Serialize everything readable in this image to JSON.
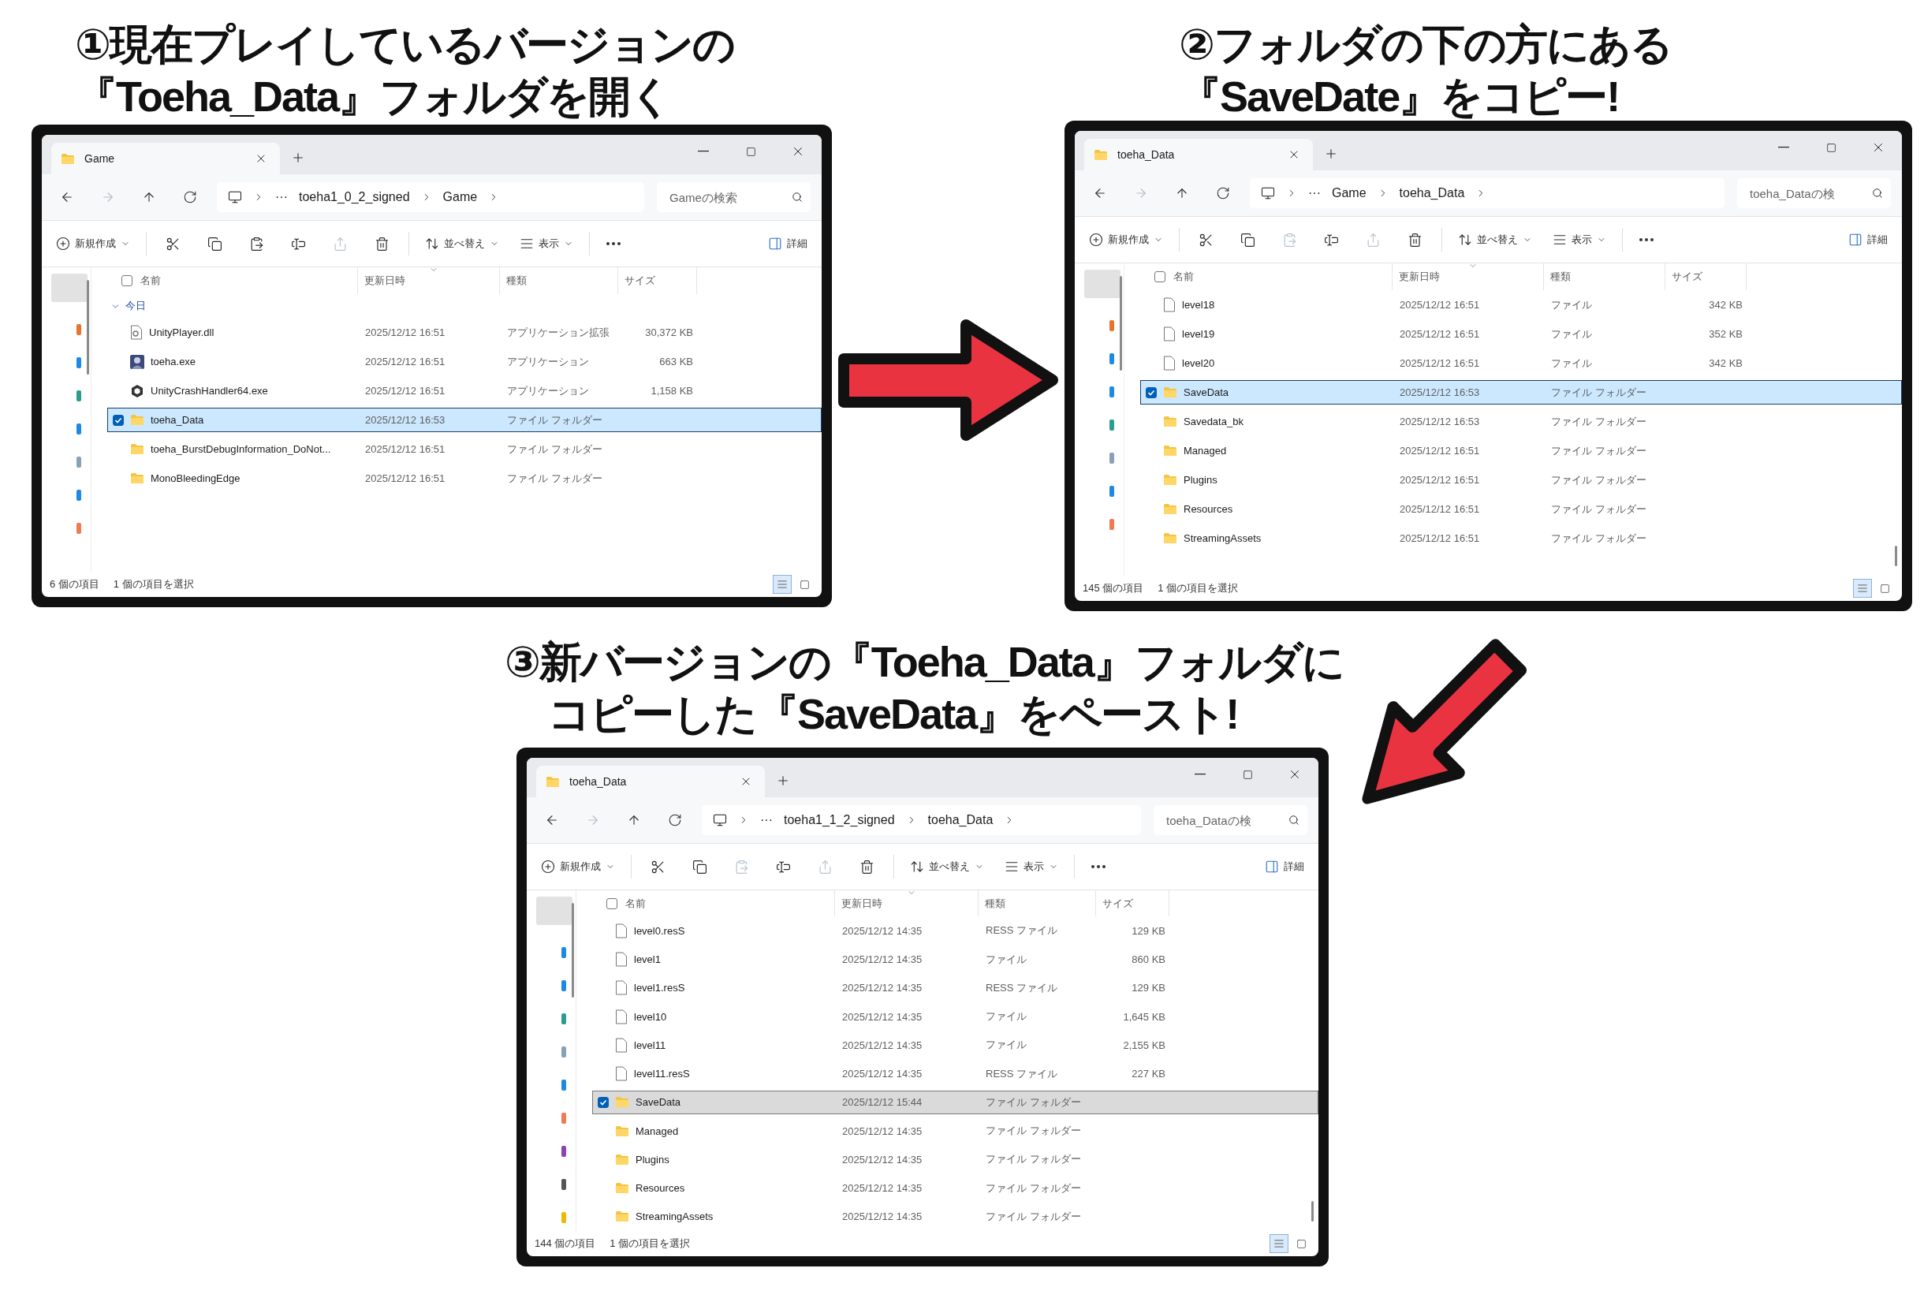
{
  "captions": [
    {
      "lines": [
        "①現在プレイしているバージョンの",
        "『Toeha_Data』フォルダを開く"
      ]
    },
    {
      "lines": [
        "②フォルダの下の方にある",
        "『SaveDate』をコピー!"
      ]
    },
    {
      "lines": [
        "③新バージョンの『Toeha_Data』フォルダに",
        "コピーした『SaveData』をペースト!"
      ]
    }
  ],
  "windows": [
    {
      "tab_title": "Game",
      "focused": true,
      "nav": [
        {
          "kind": "back",
          "disabled": false
        },
        {
          "kind": "forward",
          "disabled": true
        },
        {
          "kind": "up",
          "disabled": false
        },
        {
          "kind": "refresh",
          "disabled": false
        }
      ],
      "address": {
        "ellipsis": "···",
        "crumbs": [
          "toeha1_0_2_signed",
          "Game"
        ]
      },
      "search": {
        "placeholder": "Gameの検索"
      },
      "toolbar": [
        {
          "kind": "new",
          "label": "新規作成"
        },
        {
          "kind": "cut",
          "disabled": false
        },
        {
          "kind": "copy",
          "disabled": false
        },
        {
          "kind": "paste",
          "disabled": false
        },
        {
          "kind": "rename",
          "disabled": false
        },
        {
          "kind": "share",
          "disabled": true
        },
        {
          "kind": "delete",
          "disabled": false
        },
        {
          "kind": "sort",
          "label": "並べ替え"
        },
        {
          "kind": "view",
          "label": "表示"
        },
        {
          "kind": "more"
        },
        {
          "kind": "details",
          "label": "詳細"
        }
      ],
      "select_all": {
        "checked": false
      },
      "columns": [
        {
          "label": "名前",
          "sorted": false
        },
        {
          "label": "更新日時",
          "sorted": true
        },
        {
          "label": "種類",
          "sorted": false
        },
        {
          "label": "サイズ",
          "sorted": false
        }
      ],
      "group": {
        "label": "今日",
        "expanded": true
      },
      "rows": [
        {
          "kind": "dll",
          "name": "UnityPlayer.dll",
          "date": "2025/12/12 16:51",
          "type": "アプリケーション拡張",
          "size": "30,372 KB",
          "selected": false
        },
        {
          "kind": "app",
          "name": "toeha.exe",
          "date": "2025/12/12 16:51",
          "type": "アプリケーション",
          "size": "663 KB",
          "selected": false
        },
        {
          "kind": "unity",
          "name": "UnityCrashHandler64.exe",
          "date": "2025/12/12 16:51",
          "type": "アプリケーション",
          "size": "1,158 KB",
          "selected": false
        },
        {
          "kind": "folder",
          "name": "toeha_Data",
          "date": "2025/12/12 16:53",
          "type": "ファイル フォルダー",
          "selected": true
        },
        {
          "kind": "folder",
          "name": "toeha_BurstDebugInformation_DoNot...",
          "date": "2025/12/12 16:51",
          "type": "ファイル フォルダー",
          "selected": false
        },
        {
          "kind": "folder",
          "name": "MonoBleedingEdge",
          "date": "2025/12/12 16:51",
          "type": "ファイル フォルダー",
          "selected": false
        }
      ],
      "status": {
        "count": "6 個の項目",
        "selection": "1 個の項目を選択"
      },
      "views": [
        {
          "kind": "details",
          "selected": true
        },
        {
          "kind": "tiles",
          "selected": false
        }
      ]
    },
    {
      "tab_title": "toeha_Data",
      "focused": true,
      "nav": [
        {
          "kind": "back",
          "disabled": false
        },
        {
          "kind": "forward",
          "disabled": true
        },
        {
          "kind": "up",
          "disabled": false
        },
        {
          "kind": "refresh",
          "disabled": false
        }
      ],
      "address": {
        "ellipsis": "···",
        "crumbs": [
          "Game",
          "toeha_Data"
        ]
      },
      "search": {
        "placeholder": "toeha_Dataの検"
      },
      "toolbar": [
        {
          "kind": "new",
          "label": "新規作成"
        },
        {
          "kind": "cut",
          "disabled": false
        },
        {
          "kind": "copy",
          "disabled": false
        },
        {
          "kind": "paste",
          "disabled": true
        },
        {
          "kind": "rename",
          "disabled": false
        },
        {
          "kind": "share",
          "disabled": true
        },
        {
          "kind": "delete",
          "disabled": false
        },
        {
          "kind": "sort",
          "label": "並べ替え"
        },
        {
          "kind": "view",
          "label": "表示"
        },
        {
          "kind": "more"
        },
        {
          "kind": "details",
          "label": "詳細"
        }
      ],
      "select_all": {
        "checked": false
      },
      "columns": [
        {
          "label": "名前",
          "sorted": false
        },
        {
          "label": "更新日時",
          "sorted": true
        },
        {
          "label": "種類",
          "sorted": false
        },
        {
          "label": "サイズ",
          "sorted": false
        }
      ],
      "rows": [
        {
          "kind": "file",
          "name": "level18",
          "date": "2025/12/12 16:51",
          "type": "ファイル",
          "size": "342 KB",
          "selected": false
        },
        {
          "kind": "file",
          "name": "level19",
          "date": "2025/12/12 16:51",
          "type": "ファイル",
          "size": "352 KB",
          "selected": false
        },
        {
          "kind": "file",
          "name": "level20",
          "date": "2025/12/12 16:51",
          "type": "ファイル",
          "size": "342 KB",
          "selected": false
        },
        {
          "kind": "folder",
          "name": "SaveData",
          "date": "2025/12/12 16:53",
          "type": "ファイル フォルダー",
          "selected": true
        },
        {
          "kind": "folder",
          "name": "Savedata_bk",
          "date": "2025/12/12 16:53",
          "type": "ファイル フォルダー",
          "selected": false
        },
        {
          "kind": "folder",
          "name": "Managed",
          "date": "2025/12/12 16:51",
          "type": "ファイル フォルダー",
          "selected": false
        },
        {
          "kind": "folder",
          "name": "Plugins",
          "date": "2025/12/12 16:51",
          "type": "ファイル フォルダー",
          "selected": false
        },
        {
          "kind": "folder",
          "name": "Resources",
          "date": "2025/12/12 16:51",
          "type": "ファイル フォルダー",
          "selected": false
        },
        {
          "kind": "folder",
          "name": "StreamingAssets",
          "date": "2025/12/12 16:51",
          "type": "ファイル フォルダー",
          "selected": false
        }
      ],
      "status": {
        "count": "145 個の項目",
        "selection": "1 個の項目を選択"
      },
      "views": [
        {
          "kind": "details",
          "selected": true
        },
        {
          "kind": "tiles",
          "selected": false
        }
      ]
    },
    {
      "tab_title": "toeha_Data",
      "focused": false,
      "nav": [
        {
          "kind": "back",
          "disabled": false
        },
        {
          "kind": "forward",
          "disabled": true
        },
        {
          "kind": "up",
          "disabled": false
        },
        {
          "kind": "refresh",
          "disabled": false
        }
      ],
      "address": {
        "ellipsis": "···",
        "crumbs": [
          "toeha1_1_2_signed",
          "toeha_Data"
        ]
      },
      "search": {
        "placeholder": "toeha_Dataの検"
      },
      "toolbar": [
        {
          "kind": "new",
          "label": "新規作成"
        },
        {
          "kind": "cut",
          "disabled": false
        },
        {
          "kind": "copy",
          "disabled": false
        },
        {
          "kind": "paste",
          "disabled": true
        },
        {
          "kind": "rename",
          "disabled": false
        },
        {
          "kind": "share",
          "disabled": true
        },
        {
          "kind": "delete",
          "disabled": false
        },
        {
          "kind": "sort",
          "label": "並べ替え"
        },
        {
          "kind": "view",
          "label": "表示"
        },
        {
          "kind": "more"
        },
        {
          "kind": "details",
          "label": "詳細"
        }
      ],
      "select_all": {
        "checked": false
      },
      "columns": [
        {
          "label": "名前",
          "sorted": false
        },
        {
          "label": "更新日時",
          "sorted": true
        },
        {
          "label": "種類",
          "sorted": false
        },
        {
          "label": "サイズ",
          "sorted": false
        }
      ],
      "rows": [
        {
          "kind": "file",
          "name": "level0.resS",
          "date": "2025/12/12 14:35",
          "type": "RESS ファイル",
          "size": "129 KB",
          "selected": false
        },
        {
          "kind": "file",
          "name": "level1",
          "date": "2025/12/12 14:35",
          "type": "ファイル",
          "size": "860 KB",
          "selected": false
        },
        {
          "kind": "file",
          "name": "level1.resS",
          "date": "2025/12/12 14:35",
          "type": "RESS ファイル",
          "size": "129 KB",
          "selected": false
        },
        {
          "kind": "file",
          "name": "level10",
          "date": "2025/12/12 14:35",
          "type": "ファイル",
          "size": "1,645 KB",
          "selected": false
        },
        {
          "kind": "file",
          "name": "level11",
          "date": "2025/12/12 14:35",
          "type": "ファイル",
          "size": "2,155 KB",
          "selected": false
        },
        {
          "kind": "file",
          "name": "level11.resS",
          "date": "2025/12/12 14:35",
          "type": "RESS ファイル",
          "size": "227 KB",
          "selected": false
        },
        {
          "kind": "folder",
          "name": "SaveData",
          "date": "2025/12/12 15:44",
          "type": "ファイル フォルダー",
          "selected": true
        },
        {
          "kind": "folder",
          "name": "Managed",
          "date": "2025/12/12 14:35",
          "type": "ファイル フォルダー",
          "selected": false
        },
        {
          "kind": "folder",
          "name": "Plugins",
          "date": "2025/12/12 14:35",
          "type": "ファイル フォルダー",
          "selected": false
        },
        {
          "kind": "folder",
          "name": "Resources",
          "date": "2025/12/12 14:35",
          "type": "ファイル フォルダー",
          "selected": false
        },
        {
          "kind": "folder",
          "name": "StreamingAssets",
          "date": "2025/12/12 14:35",
          "type": "ファイル フォルダー",
          "selected": false
        }
      ],
      "status": {
        "count": "144 個の項目",
        "selection": "1 個の項目を選択"
      },
      "views": [
        {
          "kind": "details",
          "selected": true
        },
        {
          "kind": "tiles",
          "selected": false
        }
      ]
    }
  ]
}
